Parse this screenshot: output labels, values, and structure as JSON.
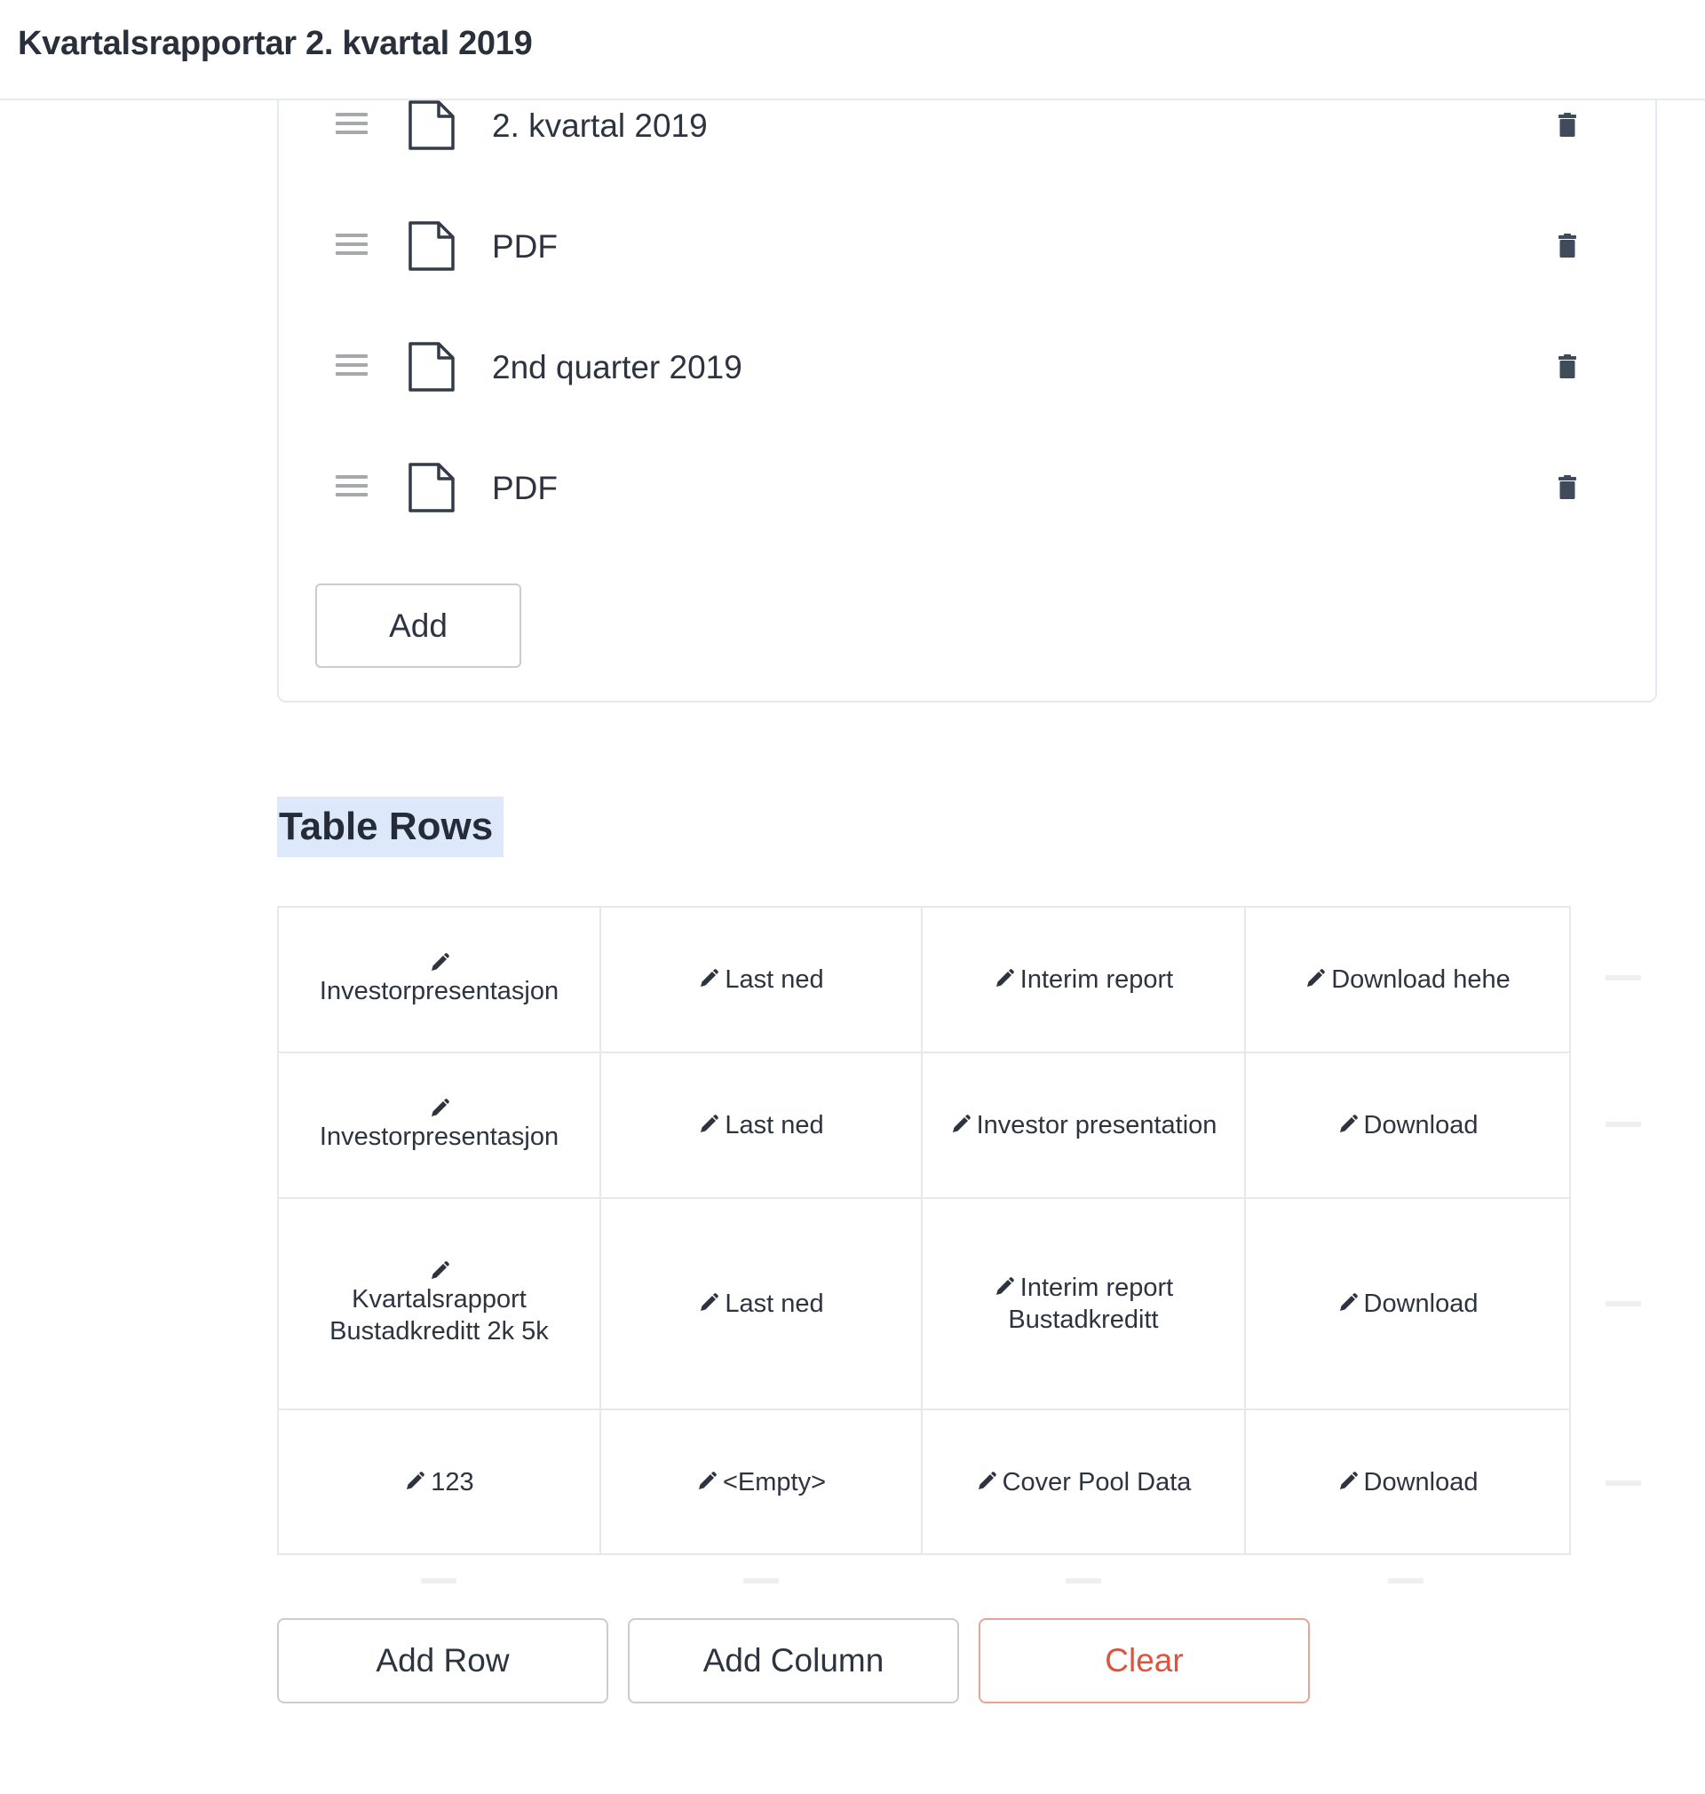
{
  "header": {
    "title": "Kvartalsrapportar 2. kvartal 2019"
  },
  "file_list": {
    "items": [
      {
        "name": "2. kvartal 2019",
        "icon": "file-icon"
      },
      {
        "name": "PDF",
        "icon": "file-icon"
      },
      {
        "name": "2nd quarter 2019",
        "icon": "file-icon"
      },
      {
        "name": "PDF",
        "icon": "file-icon"
      }
    ],
    "add_label": "Add",
    "drag_icon": "drag-handle-icon",
    "delete_icon": "trash-icon"
  },
  "table_section": {
    "heading": "Table Rows",
    "edit_icon": "pencil-icon",
    "rows": [
      [
        "Investorpresentasjon",
        "Last ned",
        "Interim report",
        "Download hehe"
      ],
      [
        "Investorpresentasjon",
        "Last ned",
        "Investor presentation",
        "Download"
      ],
      [
        "Kvartalsrapport Bustadkreditt 2k 5k",
        "Last ned",
        "Interim report Bustadkreditt",
        "Download"
      ],
      [
        "123",
        "<Empty>",
        "Cover Pool Data",
        "Download"
      ]
    ],
    "buttons": {
      "add_row": "Add Row",
      "add_column": "Add Column",
      "clear": "Clear"
    }
  },
  "colors": {
    "text": "#2d3440",
    "border": "#e6e9ee",
    "heading_highlight": "#dde8fb",
    "danger": "#d9553f",
    "icon": "#3f4a5a"
  }
}
